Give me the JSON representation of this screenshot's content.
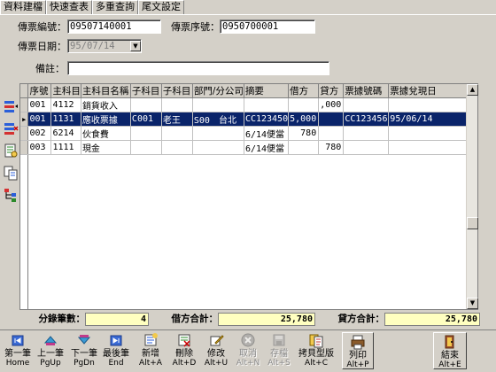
{
  "tabs": [
    "資料建檔",
    "快速查表",
    "多重查詢",
    "尾文設定"
  ],
  "form": {
    "voucher_no_label": "傳票編號：",
    "voucher_no_value": "09507140001",
    "voucher_seq_label": "傳票序號：",
    "voucher_seq_value": "0950700001",
    "voucher_date_label": "傳票日期：",
    "voucher_date_value": "95/07/14",
    "remark_label": "備註：",
    "remark_value": ""
  },
  "grid": {
    "columns": [
      "序號",
      "主科目",
      "主科目名稱",
      "子科目",
      "子科目",
      "部門/分公司",
      "摘要",
      "借方",
      "貸方",
      "票據號碼",
      "票據兌現日"
    ],
    "rows": [
      {
        "seq": "001",
        "code": "4112",
        "name": "銷貨收入",
        "sub1": "",
        "sub2": "",
        "dept": "",
        "memo": "",
        "debit": "",
        "credit": ",000",
        "bill_no": "",
        "bill_date": "",
        "selected": false,
        "indicator": ""
      },
      {
        "seq": "001",
        "code": "1131",
        "name": "應收票據",
        "sub1": "C001",
        "sub2": "老王",
        "dept": "S00　台北",
        "memo": "CC123450",
        "debit": "5,000",
        "credit": "",
        "bill_no": "CC123456",
        "bill_date": "95/06/14",
        "selected": true,
        "indicator": "▶"
      },
      {
        "seq": "002",
        "code": "6214",
        "name": "伙食費",
        "sub1": "",
        "sub2": "",
        "dept": "",
        "memo": "6/14便當",
        "debit": "780",
        "credit": "",
        "bill_no": "",
        "bill_date": "",
        "selected": false,
        "indicator": ""
      },
      {
        "seq": "003",
        "code": "1111",
        "name": "現金",
        "sub1": "",
        "sub2": "",
        "dept": "",
        "memo": "6/14便當",
        "debit": "",
        "credit": "780",
        "bill_no": "",
        "bill_date": "",
        "selected": false,
        "indicator": ""
      }
    ]
  },
  "summary": {
    "count_label": "分錄筆數：",
    "count_value": "4",
    "debit_label": "借方合計：",
    "debit_value": "25,780",
    "credit_label": "貸方合計：",
    "credit_value": "25,780"
  },
  "toolbar": [
    {
      "label": "第一筆",
      "key": "Home",
      "icon": "first-record-icon",
      "disabled": false
    },
    {
      "label": "上一筆",
      "key": "PgUp",
      "icon": "prev-record-icon",
      "disabled": false
    },
    {
      "label": "下一筆",
      "key": "PgDn",
      "icon": "next-record-icon",
      "disabled": false
    },
    {
      "label": "最後筆",
      "key": "End",
      "icon": "last-record-icon",
      "disabled": false
    },
    {
      "label": "新增",
      "key": "Alt+A",
      "icon": "add-icon",
      "disabled": false
    },
    {
      "label": "刪除",
      "key": "Alt+D",
      "icon": "delete-icon",
      "disabled": false
    },
    {
      "label": "修改",
      "key": "Alt+U",
      "icon": "edit-icon",
      "disabled": false
    },
    {
      "label": "取消",
      "key": "Alt+N",
      "icon": "cancel-icon",
      "disabled": true
    },
    {
      "label": "存檔",
      "key": "Alt+S",
      "icon": "save-icon",
      "disabled": true
    },
    {
      "label": "拷貝型版",
      "key": "Alt+C",
      "icon": "copy-template-icon",
      "disabled": false
    },
    {
      "label": "列印",
      "key": "Alt+P",
      "icon": "print-icon",
      "disabled": false
    },
    {
      "label": "結束",
      "key": "Alt+E",
      "icon": "exit-icon",
      "disabled": false
    }
  ],
  "side_buttons": [
    "insert-row-icon",
    "delete-row-icon",
    "view-icon",
    "copy-icon",
    "tree-icon"
  ]
}
